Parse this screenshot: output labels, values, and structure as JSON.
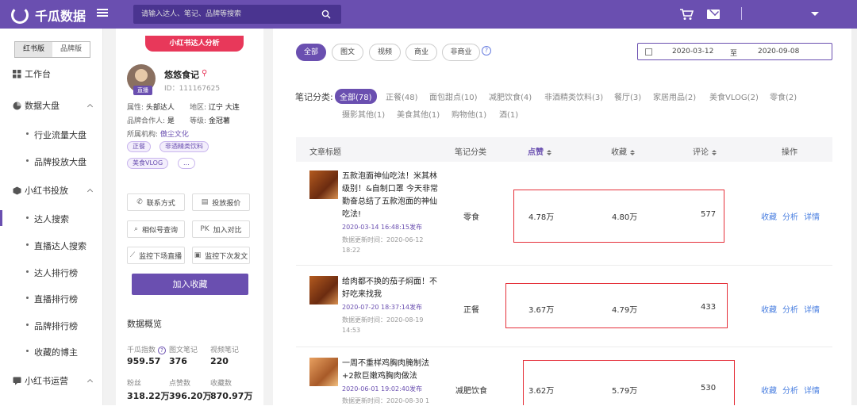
{
  "header": {
    "logo_text": "千瓜数据",
    "search_placeholder": "请输入达人、笔记、品牌等搜索"
  },
  "sidebar": {
    "version_tabs": [
      "红书版",
      "品牌版"
    ],
    "items": [
      {
        "label": "工作台",
        "icon": "grid-icon"
      },
      {
        "label": "数据大盘",
        "icon": "pie-icon"
      },
      {
        "label": "行业流量大盘"
      },
      {
        "label": "品牌投放大盘"
      },
      {
        "label": "小红书投放",
        "icon": "cube-icon"
      },
      {
        "label": "达人搜索"
      },
      {
        "label": "直播达人搜索"
      },
      {
        "label": "达人排行榜"
      },
      {
        "label": "直播排行榜"
      },
      {
        "label": "品牌排行榜"
      },
      {
        "label": "收藏的博主"
      },
      {
        "label": "小红书运营",
        "icon": "chat-icon"
      }
    ]
  },
  "profile": {
    "section_tag": "小红书达人分析",
    "live_badge": "直播",
    "nickname": "悠悠食记",
    "id_text": "ID：111167625",
    "attr_label": "属性:",
    "attr_value": "头部达人",
    "region_label": "地区:",
    "region_value": "辽宁 大连",
    "brandcoop_label": "品牌合作人:",
    "brandcoop_value": "是",
    "level_label": "等级:",
    "level_value": "金冠薯",
    "org_label": "所属机构:",
    "org_value": "傲尘文化",
    "tags": [
      "正餐",
      "非酒精类饮料",
      "美食VLOG",
      "..."
    ],
    "actions": [
      "联系方式",
      "投放报价",
      "相似号查询",
      "加入对比",
      "监控下场直播",
      "监控下次发文"
    ],
    "collect_label": "加入收藏",
    "overview_title": "数据概览",
    "stats": [
      {
        "label": "千瓜指数",
        "value": "959.57"
      },
      {
        "label": "图文笔记",
        "value": "376"
      },
      {
        "label": "视频笔记",
        "value": "220"
      },
      {
        "label": "粉丝",
        "value": "318.22万"
      },
      {
        "label": "点赞数",
        "value": "396.20万"
      },
      {
        "label": "收藏数",
        "value": "870.97万"
      }
    ]
  },
  "filters": [
    "全部",
    "图文",
    "视频",
    "商业",
    "非商业"
  ],
  "daterange": {
    "start": "2020-03-12",
    "to": "至",
    "end": "2020-09-08"
  },
  "categories": {
    "label": "笔记分类:",
    "items": [
      "全部(78)",
      "正餐(48)",
      "面包甜点(10)",
      "减肥饮食(4)",
      "非酒精类饮料(3)",
      "餐厅(3)",
      "家居用品(2)",
      "美食VLOG(2)",
      "零食(2)",
      "摄影其他(1)",
      "美食其他(1)",
      "购物他(1)",
      "酒(1)"
    ]
  },
  "table": {
    "headers": [
      "文章标题",
      "笔记分类",
      "点赞",
      "收藏",
      "评论",
      "操作"
    ],
    "rows": [
      {
        "title": "五款泡面神仙吃法！米其林级别！&自制口罩 今天非常勤奋总结了五款泡面的神仙吃法!",
        "date": "2020-03-14 16:48:15发布",
        "updated": "数据更新时间：2020-06-12 18:22",
        "category": "零食",
        "likes": "4.78万",
        "favs": "4.80万",
        "comments": "577"
      },
      {
        "title": "给肉都不换的茄子焖面！不好吃来找我",
        "date": "2020-07-20 18:37:14发布",
        "updated": "数据更新时间：2020-08-19 14:53",
        "category": "正餐",
        "likes": "3.67万",
        "favs": "4.79万",
        "comments": "433"
      },
      {
        "title": "一周不重样鸡胸肉腌制法+2款巨嫩鸡胸肉做法",
        "date": "2020-06-01 19:02:40发布",
        "updated": "数据更新时间：2020-08-30 1",
        "category": "减肥饮食",
        "likes": "3.62万",
        "favs": "5.79万",
        "comments": "530"
      }
    ],
    "actions": [
      "收藏",
      "分析",
      "详情"
    ]
  }
}
